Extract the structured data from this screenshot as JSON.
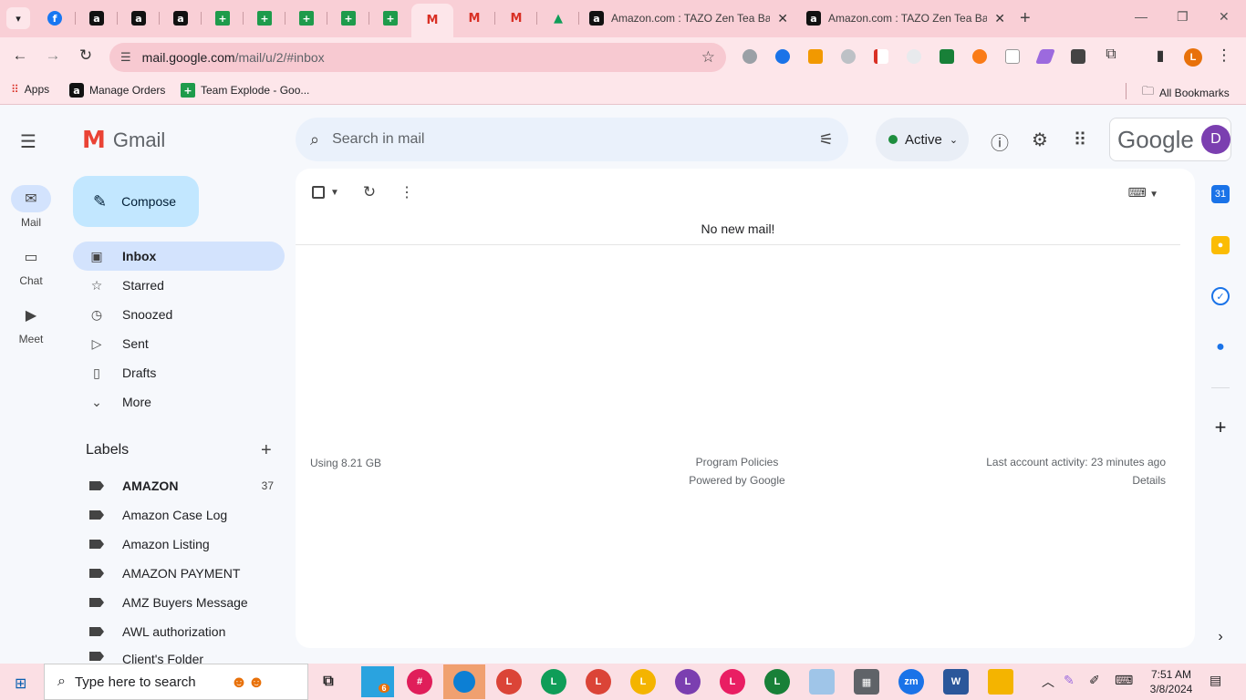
{
  "browser": {
    "pinned_tabs": [
      {
        "icon": "facebook-icon"
      },
      {
        "icon": "amazon-icon"
      },
      {
        "icon": "amazon-icon"
      },
      {
        "icon": "amazon-icon"
      },
      {
        "icon": "google-sheets-icon"
      },
      {
        "icon": "google-sheets-icon"
      },
      {
        "icon": "google-sheets-icon"
      },
      {
        "icon": "google-sheets-icon"
      },
      {
        "icon": "google-sheets-icon"
      },
      {
        "icon": "gmail-icon",
        "active": true
      },
      {
        "icon": "gmail-icon"
      },
      {
        "icon": "gmail-icon"
      },
      {
        "icon": "google-drive-icon"
      }
    ],
    "tabs": [
      {
        "title": "Amazon.com : TAZO Zen Tea Ba"
      },
      {
        "title": "Amazon.com : TAZO Zen Tea Ba"
      }
    ],
    "url_host": "mail.google.com",
    "url_path": "/mail/u/2/#inbox",
    "profile_initial": "L",
    "bookmarks": [
      {
        "label": "Apps"
      },
      {
        "label": "Manage Orders"
      },
      {
        "label": "Team Explode - Goo..."
      }
    ],
    "all_bookmarks": "All Bookmarks"
  },
  "gmail": {
    "app_name": "Gmail",
    "rail": [
      {
        "label": "Mail"
      },
      {
        "label": "Chat"
      },
      {
        "label": "Meet"
      }
    ],
    "compose": "Compose",
    "nav": [
      {
        "label": "Inbox"
      },
      {
        "label": "Starred"
      },
      {
        "label": "Snoozed"
      },
      {
        "label": "Sent"
      },
      {
        "label": "Drafts"
      },
      {
        "label": "More"
      }
    ],
    "labels_title": "Labels",
    "labels": [
      {
        "name": "AMAZON",
        "count": "37"
      },
      {
        "name": "Amazon Case Log",
        "count": ""
      },
      {
        "name": "Amazon Listing",
        "count": ""
      },
      {
        "name": "AMAZON PAYMENT",
        "count": ""
      },
      {
        "name": "AMZ Buyers Message",
        "count": ""
      },
      {
        "name": "AWL authorization",
        "count": ""
      },
      {
        "name": "Client's Folder",
        "count": ""
      }
    ],
    "search_placeholder": "Search in mail",
    "status": "Active",
    "google_wordmark": "Google",
    "avatar_initial": "D",
    "empty_message": "No new mail!",
    "storage": "Using 8.21 GB",
    "program_policies": "Program Policies",
    "powered_by": "Powered by Google",
    "last_activity": "Last account activity: 23 minutes ago",
    "details": "Details"
  },
  "taskbar": {
    "search_placeholder": "Type here to search",
    "time": "7:51 AM",
    "date": "3/8/2024",
    "telegram_badge": "6"
  },
  "colors": {
    "chrome_pink": "#f9cfd6",
    "toolbar_pink": "#fde6ea",
    "gmail_bg": "#f6f8fc",
    "compose_blue": "#c2e7ff",
    "inbox_active": "#d3e3fd",
    "status_green": "#1e8e3e",
    "avatar_purple": "#7b3fb0"
  }
}
